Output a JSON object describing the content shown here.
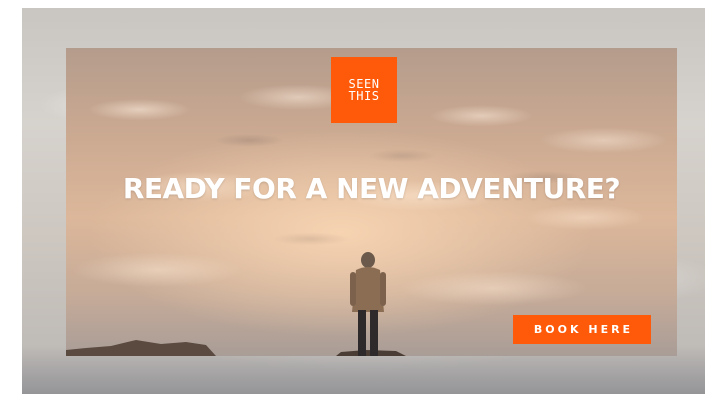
{
  "ad": {
    "logo": {
      "line1": "SEEN",
      "line2": "THIS",
      "color": "#ff5a0a"
    },
    "headline": "READY FOR A NEW ADVENTURE?",
    "cta_label": "BOOK HERE",
    "accent_color": "#ff5a0a",
    "background_image": "person standing above sea of clouds at sunset"
  }
}
